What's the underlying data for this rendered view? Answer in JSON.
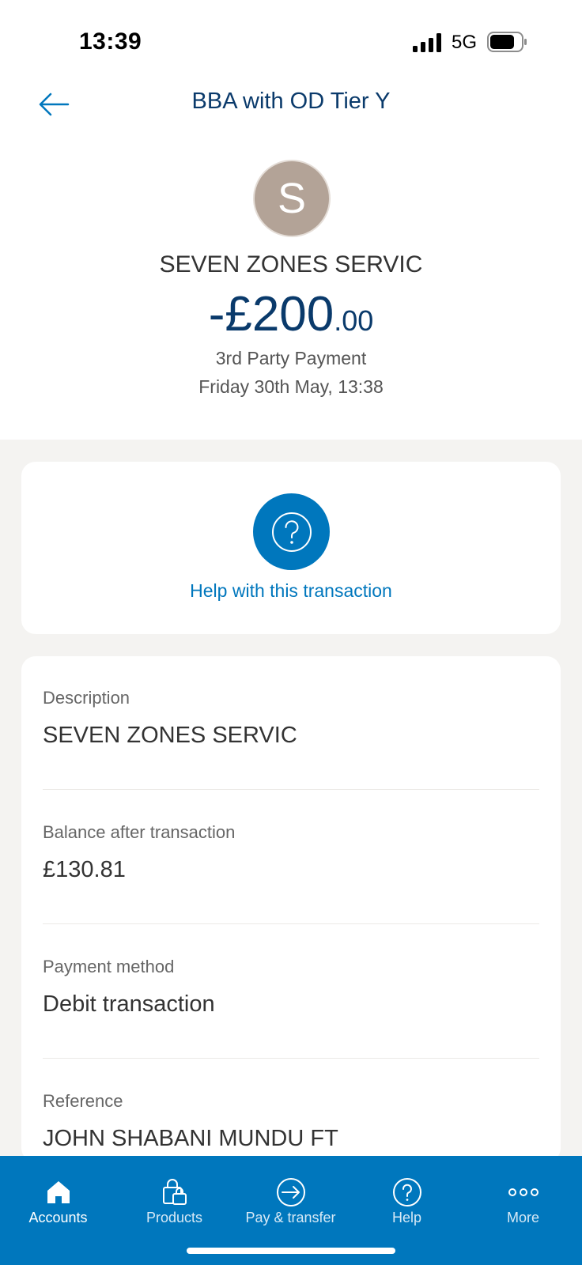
{
  "status_bar": {
    "time": "13:39",
    "network": "5G"
  },
  "header": {
    "title": "BBA with OD Tier Y",
    "back_icon": "arrow-left-icon"
  },
  "transaction": {
    "avatar_initial": "S",
    "merchant": "SEVEN ZONES SERVIC",
    "amount_major": "-£200",
    "amount_minor": ".00",
    "type": "3rd Party Payment",
    "date": "Friday 30th May, 13:38"
  },
  "help": {
    "icon": "question-circle-icon",
    "label": "Help with this transaction"
  },
  "details": [
    {
      "label": "Description",
      "value": "SEVEN ZONES SERVIC"
    },
    {
      "label": "Balance after transaction",
      "value": "£130.81"
    },
    {
      "label": "Payment method",
      "value": "Debit transaction"
    },
    {
      "label": "Reference",
      "value": "JOHN SHABANI MUNDU FT"
    }
  ],
  "tabbar": {
    "tabs": [
      {
        "label": "Accounts",
        "icon": "home-icon",
        "active": true
      },
      {
        "label": "Products",
        "icon": "shopping-bag-icon",
        "active": false
      },
      {
        "label": "Pay & transfer",
        "icon": "transfer-arrow-icon",
        "active": false
      },
      {
        "label": "Help",
        "icon": "help-icon",
        "active": false
      },
      {
        "label": "More",
        "icon": "more-dots-icon",
        "active": false
      }
    ]
  },
  "colors": {
    "brand_blue": "#0077bd",
    "navy": "#0a3a6b",
    "avatar": "#b3a397",
    "background": "#f4f3f1"
  }
}
